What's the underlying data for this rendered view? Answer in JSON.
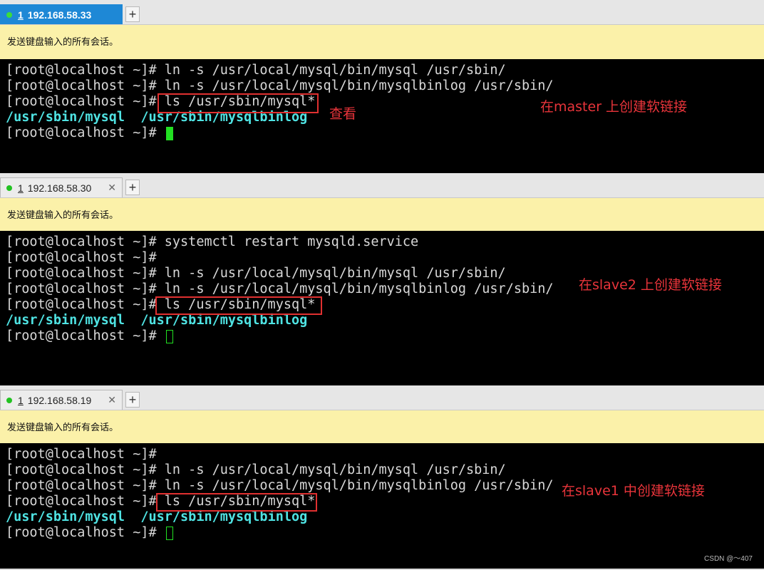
{
  "notice_text": "发送键盘输入的所有会话。",
  "panels": [
    {
      "tab": {
        "num": "1",
        "host": "192.168.58.33",
        "close": ""
      },
      "lines": [
        {
          "prompt": "[root@localhost ~]# ",
          "cmd": "ln -s /usr/local/mysql/bin/mysql /usr/sbin/"
        },
        {
          "prompt": "[root@localhost ~]# ",
          "cmd": "ln -s /usr/local/mysql/bin/mysqlbinlog /usr/sbin/"
        },
        {
          "prompt": "[root@localhost ~]# ",
          "cmd": "ls /usr/sbin/mysql*"
        }
      ],
      "ls_output": [
        "/usr/sbin/mysql",
        "/usr/sbin/mysqlbinlog"
      ],
      "last_prompt": "[root@localhost ~]# ",
      "annotation_main": "在master 上创建软链接",
      "annotation_side": "查看"
    },
    {
      "tab": {
        "num": "1",
        "host": "192.168.58.30",
        "close": "✕"
      },
      "lines": [
        {
          "prompt": "[root@localhost ~]# ",
          "cmd": "systemctl restart mysqld.service"
        },
        {
          "prompt": "[root@localhost ~]# ",
          "cmd": ""
        },
        {
          "prompt": "[root@localhost ~]# ",
          "cmd": "ln -s /usr/local/mysql/bin/mysql /usr/sbin/"
        },
        {
          "prompt": "[root@localhost ~]# ",
          "cmd": "ln -s /usr/local/mysql/bin/mysqlbinlog /usr/sbin/"
        },
        {
          "prompt": "[root@localhost ~]# ",
          "cmd": "ls /usr/sbin/mysql*"
        }
      ],
      "ls_output": [
        "/usr/sbin/mysql",
        "/usr/sbin/mysqlbinlog"
      ],
      "last_prompt": "[root@localhost ~]# ",
      "annotation_main": "在slave2 上创建软链接"
    },
    {
      "tab": {
        "num": "1",
        "host": "192.168.58.19",
        "close": "✕"
      },
      "lines": [
        {
          "prompt": "[root@localhost ~]# ",
          "cmd": ""
        },
        {
          "prompt": "[root@localhost ~]# ",
          "cmd": "ln -s /usr/local/mysql/bin/mysql /usr/sbin/"
        },
        {
          "prompt": "[root@localhost ~]# ",
          "cmd": "ln -s /usr/local/mysql/bin/mysqlbinlog /usr/sbin/"
        },
        {
          "prompt": "[root@localhost ~]# ",
          "cmd": "ls /usr/sbin/mysql*"
        }
      ],
      "ls_output": [
        "/usr/sbin/mysql",
        "/usr/sbin/mysqlbinlog"
      ],
      "last_prompt": "[root@localhost ~]# ",
      "annotation_main": "在slave1 中创建软链接"
    }
  ],
  "add_tab_label": "+",
  "watermark": "CSDN @～407",
  "colors": {
    "active_tab": "#1e88d6",
    "notice_bg": "#fbf1a9",
    "ls_output": "#4fe3e3",
    "cursor": "#22e022",
    "annotation": "#e8343a"
  }
}
